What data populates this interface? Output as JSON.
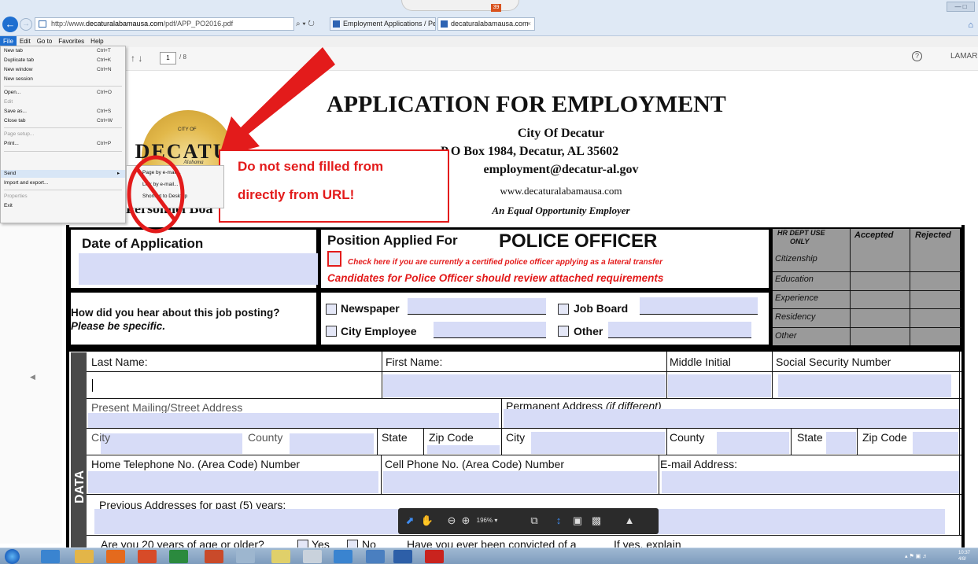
{
  "browser": {
    "url_prefix": "http://www.",
    "url_domain": "decaturalabamausa.com",
    "url_path": "/pdf/APP_PO2016.pdf",
    "addr_tools": "⌕ ▾ ↻",
    "tabs": [
      {
        "label": "Employment Applications / Pe..."
      },
      {
        "label": "decaturalabamausa.com",
        "close": "×"
      }
    ],
    "notif_badge": "39",
    "window_buttons": "— □",
    "menu": [
      "File",
      "Edit",
      "Go to",
      "Favorites",
      "Help"
    ]
  },
  "pdf_toolbar": {
    "nav": "↑ ↓",
    "page_current": "1",
    "page_total": "/ 8",
    "help": "?",
    "user": "LAMAR"
  },
  "file_menu": {
    "items": [
      {
        "label": "New tab",
        "shortcut": "Ctrl+T"
      },
      {
        "label": "Duplicate tab",
        "shortcut": "Ctrl+K"
      },
      {
        "label": "New window",
        "shortcut": "Ctrl+N"
      },
      {
        "label": "New session",
        "shortcut": ""
      },
      {
        "label": "Open...",
        "shortcut": "Ctrl+O"
      },
      {
        "label": "Edit",
        "shortcut": ""
      },
      {
        "label": "Save as...",
        "shortcut": "Ctrl+S"
      },
      {
        "label": "Close tab",
        "shortcut": "Ctrl+W"
      },
      {
        "label": "Page setup...",
        "shortcut": ""
      },
      {
        "label": "Print...",
        "shortcut": "Ctrl+P"
      },
      {
        "label": "Send",
        "shortcut": ""
      },
      {
        "label": "Import and export...",
        "shortcut": ""
      },
      {
        "label": "Properties",
        "shortcut": ""
      },
      {
        "label": "Exit",
        "shortcut": ""
      }
    ],
    "submenu": [
      {
        "label": "Page by e-mail..."
      },
      {
        "label": "Link by e-mail..."
      },
      {
        "label": "Shortcut to Desktop"
      }
    ]
  },
  "header": {
    "logo_small": "CITY OF",
    "logo_word": "DECATUR",
    "logo_sub": "Alabama",
    "personnel": "Personnel Boa",
    "title": "APPLICATION FOR EMPLOYMENT",
    "city": "City Of Decatur",
    "address": "P O Box 1984, Decatur, AL  35602",
    "email": "employment@decatur-al.gov",
    "website": "www.decaturalabamausa.com",
    "eoe": "An Equal Opportunity Employer"
  },
  "annotation": {
    "note_line1": "Do not send filled from",
    "note_line2": "directly from URL!",
    "colors": {
      "arrow": "#e31b1b"
    }
  },
  "form": {
    "date_label": "Date of Application",
    "position_label": "Position Applied For",
    "position_value": "POLICE OFFICER",
    "lateral_text": "Check here if you are currently a certified police officer applying as a lateral transfer",
    "candidates_text": "Candidates for Police Officer should review attached requirements",
    "hr": {
      "title1": "HR DEPT USE",
      "title2": "ONLY",
      "accepted": "Accepted",
      "rejected": "Rejected",
      "rows": [
        "Citizenship",
        "Education",
        "Experience",
        "Residency",
        "Other"
      ]
    },
    "hear_q": "How did you hear about this job posting?",
    "hear_sub": "Please be specific.",
    "opt_newspaper": "Newspaper",
    "opt_jobboard": "Job Board",
    "opt_cityemp": "City Employee",
    "opt_other": "Other",
    "last_name": "Last Name:",
    "first_name": "First Name:",
    "middle_initial": "Middle Initial",
    "ssn": "Social Security Number",
    "present_addr": "Present Mailing/Street Address",
    "perm_addr": "Permanent Address",
    "perm_addr_note": "(if different)",
    "city": "City",
    "county": "County",
    "state": "State",
    "zip": "Zip Code",
    "home_phone": "Home Telephone No. (Area Code) Number",
    "cell_phone": "Cell Phone No. (Area Code) Number",
    "email_addr": "E-mail Address:",
    "prev_addr": "Previous Addresses for past (5) years:",
    "side_label": "DATA",
    "age_q": "Are you 20 years of age or older?",
    "yes": "Yes",
    "no": "No",
    "convicted_q": "Have you ever been convicted of a",
    "if_yes": "If yes, explain"
  },
  "float_toolbar": {
    "zoom": "196%",
    "zoom_caret": "▾"
  },
  "taskbar": {
    "clock_time": "10:37",
    "clock_date": "4/8/"
  }
}
